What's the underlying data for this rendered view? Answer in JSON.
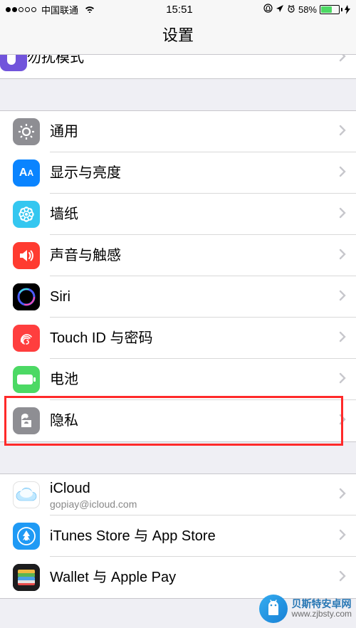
{
  "status": {
    "carrier": "中国联通",
    "time": "15:51",
    "battery_text": "58%"
  },
  "title": "设置",
  "partial_row": {
    "label": "勿扰模式"
  },
  "group2": [
    {
      "id": "general",
      "label": "通用",
      "icon_bg": "#8e8e93"
    },
    {
      "id": "display",
      "label": "显示与亮度",
      "icon_bg": "#0a84ff"
    },
    {
      "id": "wallpaper",
      "label": "墙纸",
      "icon_bg": "#34c7f0"
    },
    {
      "id": "sounds",
      "label": "声音与触感",
      "icon_bg": "#ff3b30"
    },
    {
      "id": "siri",
      "label": "Siri",
      "icon_bg": "#000000"
    },
    {
      "id": "touchid",
      "label": "Touch ID 与密码",
      "icon_bg": "#ff3e3e"
    },
    {
      "id": "battery",
      "label": "电池",
      "icon_bg": "#4cd964"
    },
    {
      "id": "privacy",
      "label": "隐私",
      "icon_bg": "#8e8e93"
    }
  ],
  "group3": [
    {
      "id": "icloud",
      "label": "iCloud",
      "sublabel": "gopiay@icloud.com",
      "icon_bg": "#ffffff"
    },
    {
      "id": "itunes",
      "label": "iTunes Store 与 App Store",
      "icon_bg": "#1f9af5"
    },
    {
      "id": "wallet",
      "label": "Wallet 与 Apple Pay",
      "icon_bg": "#1c1c1e"
    }
  ],
  "highlight_row_id": "privacy",
  "watermark": {
    "brand": "贝斯特安卓网",
    "url": "www.zjbsty.com"
  }
}
